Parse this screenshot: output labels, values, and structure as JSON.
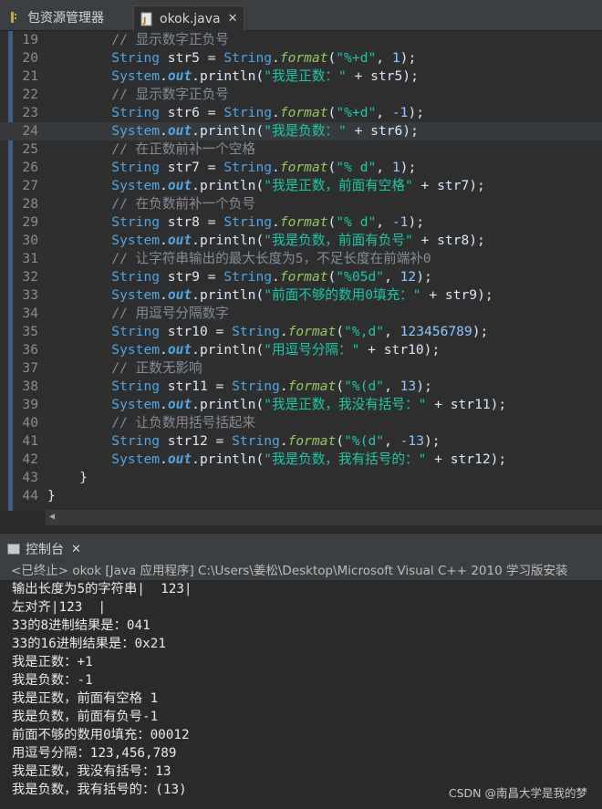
{
  "tabs": {
    "package_explorer": "包资源管理器",
    "editor_file": "okok.java"
  },
  "code_lines": [
    {
      "n": "19",
      "t": "        // 显示数字正负号"
    },
    {
      "n": "20",
      "t": "        String str5 = String.format(\"%+d\", 1);"
    },
    {
      "n": "21",
      "t": "        System.out.println(\"我是正数：\" + str5);"
    },
    {
      "n": "22",
      "t": "        // 显示数字正负号"
    },
    {
      "n": "23",
      "t": "        String str6 = String.format(\"%+d\", -1);"
    },
    {
      "n": "24",
      "t": "        System.out.println(\"我是负数：\" + str6);"
    },
    {
      "n": "25",
      "t": "        // 在正数前补一个空格"
    },
    {
      "n": "26",
      "t": "        String str7 = String.format(\"% d\", 1);"
    },
    {
      "n": "27",
      "t": "        System.out.println(\"我是正数，前面有空格\" + str7);"
    },
    {
      "n": "28",
      "t": "        // 在负数前补一个负号"
    },
    {
      "n": "29",
      "t": "        String str8 = String.format(\"% d\", -1);"
    },
    {
      "n": "30",
      "t": "        System.out.println(\"我是负数，前面有负号\" + str8);"
    },
    {
      "n": "31",
      "t": "        // 让字符串输出的最大长度为5，不足长度在前端补0"
    },
    {
      "n": "32",
      "t": "        String str9 = String.format(\"%05d\", 12);"
    },
    {
      "n": "33",
      "t": "        System.out.println(\"前面不够的数用0填充：\" + str9);"
    },
    {
      "n": "34",
      "t": "        // 用逗号分隔数字"
    },
    {
      "n": "35",
      "t": "        String str10 = String.format(\"%,d\", 123456789);"
    },
    {
      "n": "36",
      "t": "        System.out.println(\"用逗号分隔：\" + str10);"
    },
    {
      "n": "37",
      "t": "        // 正数无影响"
    },
    {
      "n": "38",
      "t": "        String str11 = String.format(\"%(d\", 13);"
    },
    {
      "n": "39",
      "t": "        System.out.println(\"我是正数，我没有括号：\" + str11);"
    },
    {
      "n": "40",
      "t": "        // 让负数用括号括起来"
    },
    {
      "n": "41",
      "t": "        String str12 = String.format(\"%(d\", -13);"
    },
    {
      "n": "42",
      "t": "        System.out.println(\"我是负数，我有括号的：\" + str12);"
    },
    {
      "n": "43",
      "t": "    }"
    },
    {
      "n": "44",
      "t": "}"
    }
  ],
  "highlighted_line": "24",
  "console": {
    "tab_label": "控制台",
    "header": "<已终止> okok [Java 应用程序] C:\\Users\\姜松\\Desktop\\Microsoft Visual C++ 2010 学习版安装",
    "lines": [
      "输出长度为5的字符串|  123|",
      "左对齐|123  |",
      "33的8进制结果是：041",
      "33的16进制结果是：0x21",
      "我是正数：+1",
      "我是负数：-1",
      "我是正数，前面有空格 1",
      "我是负数，前面有负号-1",
      "前面不够的数用0填充：00012",
      "用逗号分隔：123,456,789",
      "我是正数，我没有括号：13",
      "我是负数，我有括号的：(13)"
    ]
  },
  "watermark": "CSDN @南昌大学是我的梦",
  "colors": {
    "keyword": "#4ea6e6",
    "string": "#18c9a8",
    "comment": "#808d99",
    "method": "#93c763",
    "background": "#2f2f2f"
  }
}
